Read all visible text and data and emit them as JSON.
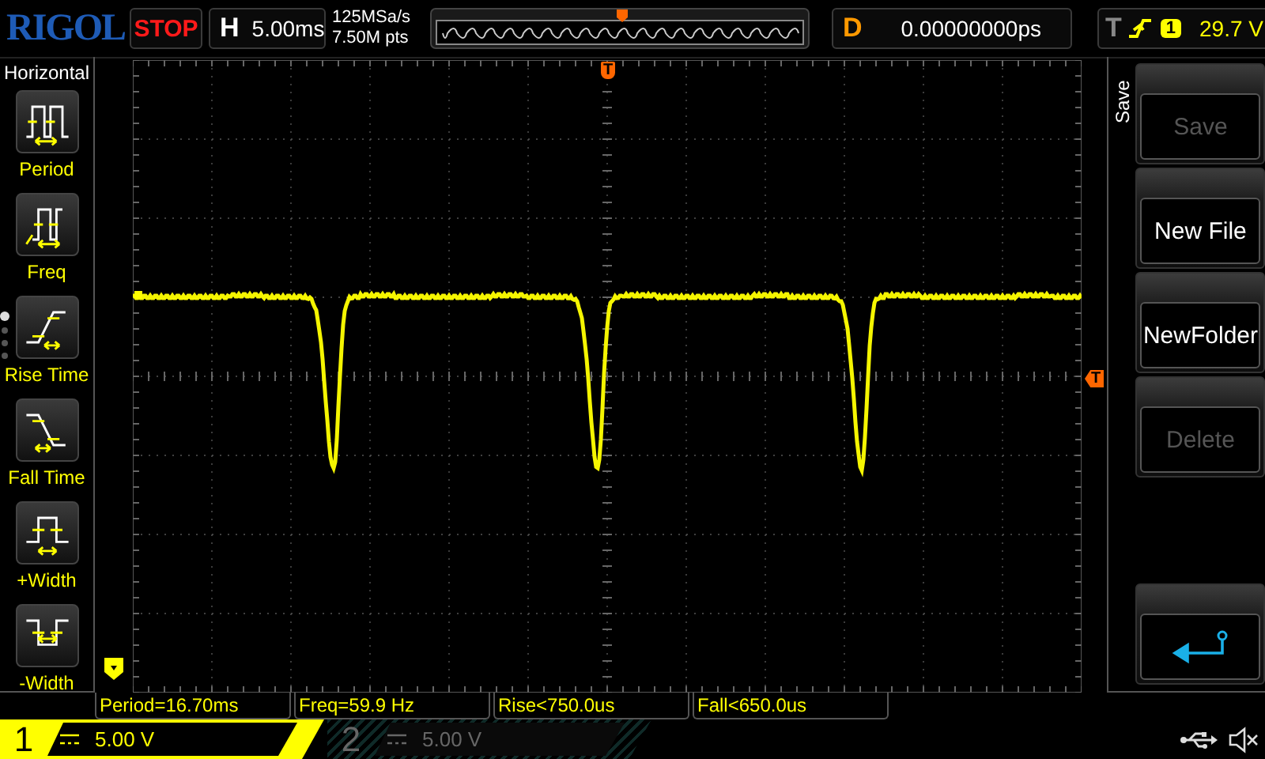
{
  "logo": "RIGOL",
  "run_state": "STOP",
  "timebase": {
    "label": "H",
    "value": "5.00ms"
  },
  "sample_rate": "125MSa/s",
  "memory_depth": "7.50M pts",
  "delay": {
    "label": "D",
    "value": "0.00000000ps"
  },
  "trigger": {
    "label": "T",
    "rising_edge": true,
    "source": "1",
    "level": "29.7 V"
  },
  "left_menu": {
    "title": "Horizontal",
    "items": [
      {
        "label": "Period",
        "kind": "period"
      },
      {
        "label": "Freq",
        "kind": "freq"
      },
      {
        "label": "Rise Time",
        "kind": "rise"
      },
      {
        "label": "Fall Time",
        "kind": "fall"
      },
      {
        "label": "+Width",
        "kind": "pwidth"
      },
      {
        "label": "-Width",
        "kind": "nwidth"
      }
    ]
  },
  "page_indicator": [
    {
      "selected": true
    },
    {
      "selected": false
    },
    {
      "selected": false
    },
    {
      "selected": false
    }
  ],
  "markers": {
    "trigger_position": "T",
    "trigger_level": "T"
  },
  "measurements": [
    "Period=16.70ms",
    "Freq=59.9 Hz",
    "Rise<750.0us",
    "Fall<650.0us"
  ],
  "soft_menu": {
    "title": "Save",
    "buttons": [
      {
        "kind": "text",
        "label": "Save",
        "disabled": true
      },
      {
        "kind": "text",
        "label": "New File",
        "disabled": false
      },
      {
        "kind": "text",
        "label": "NewFolder",
        "disabled": false
      },
      {
        "kind": "text",
        "label": "Delete",
        "disabled": true
      },
      {
        "kind": "back"
      }
    ]
  },
  "channels": [
    {
      "number": "1",
      "scale": "5.00 V",
      "on": true
    },
    {
      "number": "2",
      "scale": "5.00 V",
      "on": false
    }
  ]
}
